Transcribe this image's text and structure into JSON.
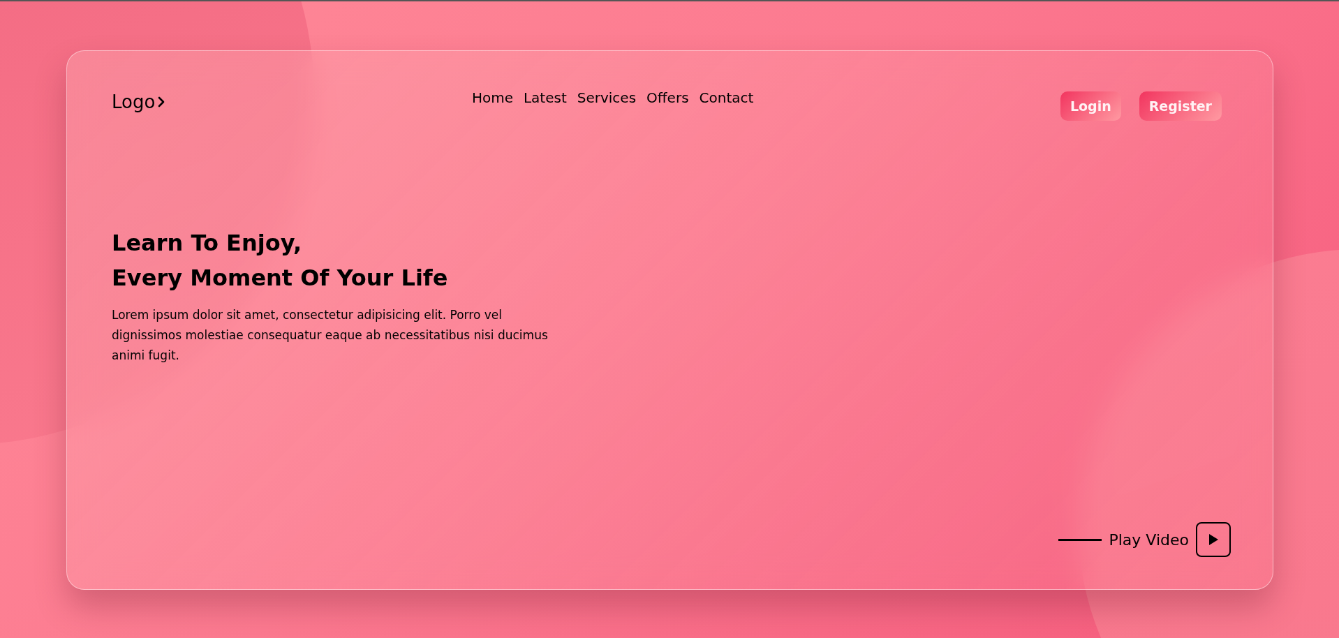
{
  "logo": {
    "text": "Logo"
  },
  "nav": [
    {
      "label": "Home"
    },
    {
      "label": "Latest"
    },
    {
      "label": "Services"
    },
    {
      "label": "Offers"
    },
    {
      "label": "Contact"
    }
  ],
  "auth_buttons": [
    {
      "label": "Login"
    },
    {
      "label": "Register"
    }
  ],
  "hero": {
    "title_lines": [
      "Learn To Enjoy,",
      "Every Moment Of Your Life"
    ],
    "text": "Lorem ipsum dolor sit amet, consectetur adipisicing elit. Porro vel dignissimos molestiae consequatur eaque ab necessitatibus nisi ducimus animi fugit."
  },
  "play_video": {
    "label": "Play Video"
  }
}
